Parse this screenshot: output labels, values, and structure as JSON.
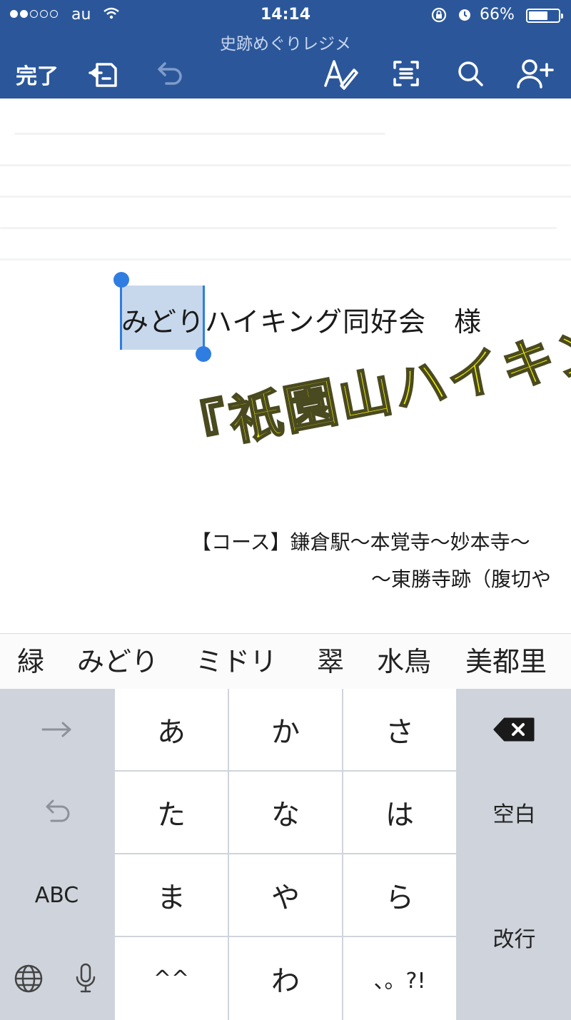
{
  "status_bar": {
    "carrier": "au",
    "time": "14:14",
    "battery_percent_text": "66%",
    "battery_level": 0.66,
    "signal_bars_filled": 2,
    "signal_bars_total": 5
  },
  "toolbar": {
    "doc_title": "史跡めぐりレジメ",
    "done_label": "完了",
    "icons": [
      "save-copy-icon",
      "undo-icon",
      "text-format-icon",
      "read-mode-icon",
      "search-icon",
      "share-person-icon"
    ]
  },
  "document": {
    "addressee_selected": "みどり",
    "addressee_rest": "ハイキング同好会　様",
    "wordart_title": "『祇園山ハイキング",
    "course_line1": "【コース】鎌倉駅～本覚寺～妙本寺～",
    "course_line2": "～東勝寺跡（腹切や",
    "course_line3": "（:"
  },
  "keyboard": {
    "candidates": [
      "緑",
      "みどり",
      "ミドリ",
      "翠",
      "水鳥",
      "美都里"
    ],
    "rows": [
      [
        "あ",
        "か",
        "さ"
      ],
      [
        "た",
        "な",
        "は"
      ],
      [
        "ま",
        "や",
        "ら"
      ],
      [
        "^^",
        "わ",
        "、。?!"
      ]
    ],
    "space_label": "空白",
    "return_label": "改行",
    "abc_label": "ABC",
    "icons": {
      "next": "arrow-right-icon",
      "undo": "undo-icon",
      "delete": "delete-icon",
      "globe": "globe-icon",
      "mic": "microphone-icon"
    }
  },
  "colors": {
    "toolbar_bg": "#2b579a",
    "selection": "#c7d8ec",
    "cursor": "#2f7de1",
    "wordart_fill": "#f3f000",
    "keyboard_bg": "#cfd4dc"
  }
}
